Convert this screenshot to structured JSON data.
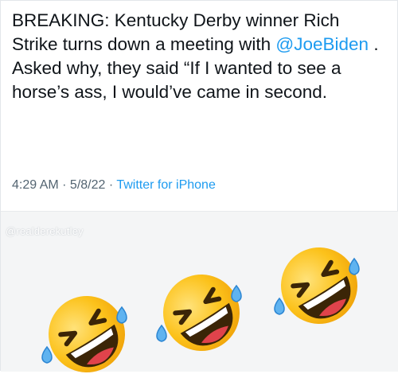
{
  "tweet": {
    "text_before": "BREAKING: Kentucky Derby winner Rich Strike turns down a meeting with ",
    "mention": "@JoeBiden",
    "text_after": " . Asked why, they said “If I wanted to see a horse’s ass, I would’ve came in second.",
    "time": "4:29 AM",
    "sep1": " · ",
    "date": "5/8/22",
    "sep2": " · ",
    "source": "Twitter for iPhone"
  },
  "image": {
    "watermark": "@realderekutley",
    "emojis": [
      "rolling-on-floor-laughing-emoji",
      "rolling-on-floor-laughing-emoji",
      "rolling-on-floor-laughing-emoji"
    ]
  },
  "colors": {
    "text": "#0f1419",
    "link": "#1d9bf0",
    "meta": "#536471",
    "emoji_face": "#fcc21b"
  }
}
